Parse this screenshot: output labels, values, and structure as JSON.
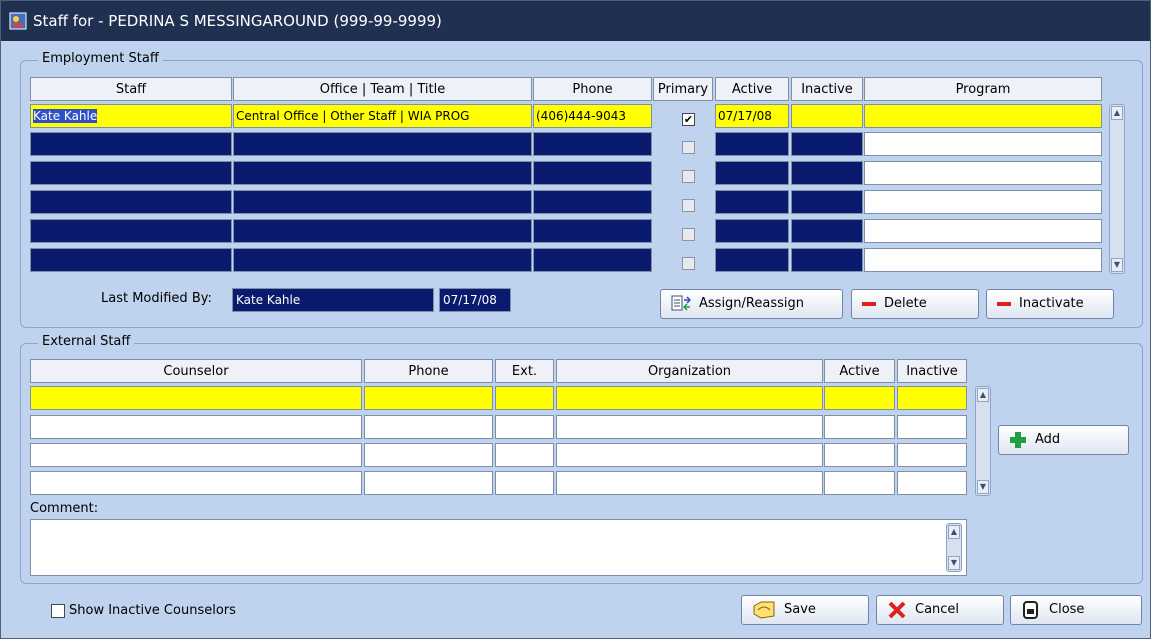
{
  "window": {
    "title": "Staff for - PEDRINA S MESSINGAROUND (999-99-9999)"
  },
  "employment_staff": {
    "group_label": "Employment Staff",
    "columns": [
      "Staff",
      "Office | Team | Title",
      "Phone",
      "Primary",
      "Active",
      "Inactive",
      "Program"
    ],
    "rows": [
      {
        "staff": "Kate Kahle",
        "office": "Central Office | Other Staff | WIA PROG",
        "phone": "(406)444-9043",
        "primary": "✔",
        "active": "07/17/08",
        "inactive": "",
        "program": ""
      },
      {
        "staff": "",
        "office": "",
        "phone": "",
        "primary": "",
        "active": "",
        "inactive": "",
        "program": ""
      },
      {
        "staff": "",
        "office": "",
        "phone": "",
        "primary": "",
        "active": "",
        "inactive": "",
        "program": ""
      },
      {
        "staff": "",
        "office": "",
        "phone": "",
        "primary": "",
        "active": "",
        "inactive": "",
        "program": ""
      },
      {
        "staff": "",
        "office": "",
        "phone": "",
        "primary": "",
        "active": "",
        "inactive": "",
        "program": ""
      },
      {
        "staff": "",
        "office": "",
        "phone": "",
        "primary": "",
        "active": "",
        "inactive": "",
        "program": ""
      }
    ],
    "last_modified_label": "Last Modified By:",
    "last_modified_by": "Kate Kahle",
    "last_modified_date": "07/17/08",
    "buttons": {
      "assign": "Assign/Reassign",
      "delete": "Delete",
      "inactivate": "Inactivate"
    }
  },
  "external_staff": {
    "group_label": "External Staff",
    "columns": [
      "Counselor",
      "Phone",
      "Ext.",
      "Organization",
      "Active",
      "Inactive"
    ],
    "add_button": "Add",
    "comment_label": "Comment:",
    "comment_value": ""
  },
  "footer": {
    "show_inactive_label": "Show Inactive Counselors",
    "save": "Save",
    "cancel": "Cancel",
    "close": "Close"
  },
  "colors": {
    "navy_cell": "#0a1a6e",
    "highlight_row": "#ffff00",
    "panel_bg": "#bfd2ee",
    "titlebar": "#203050"
  }
}
